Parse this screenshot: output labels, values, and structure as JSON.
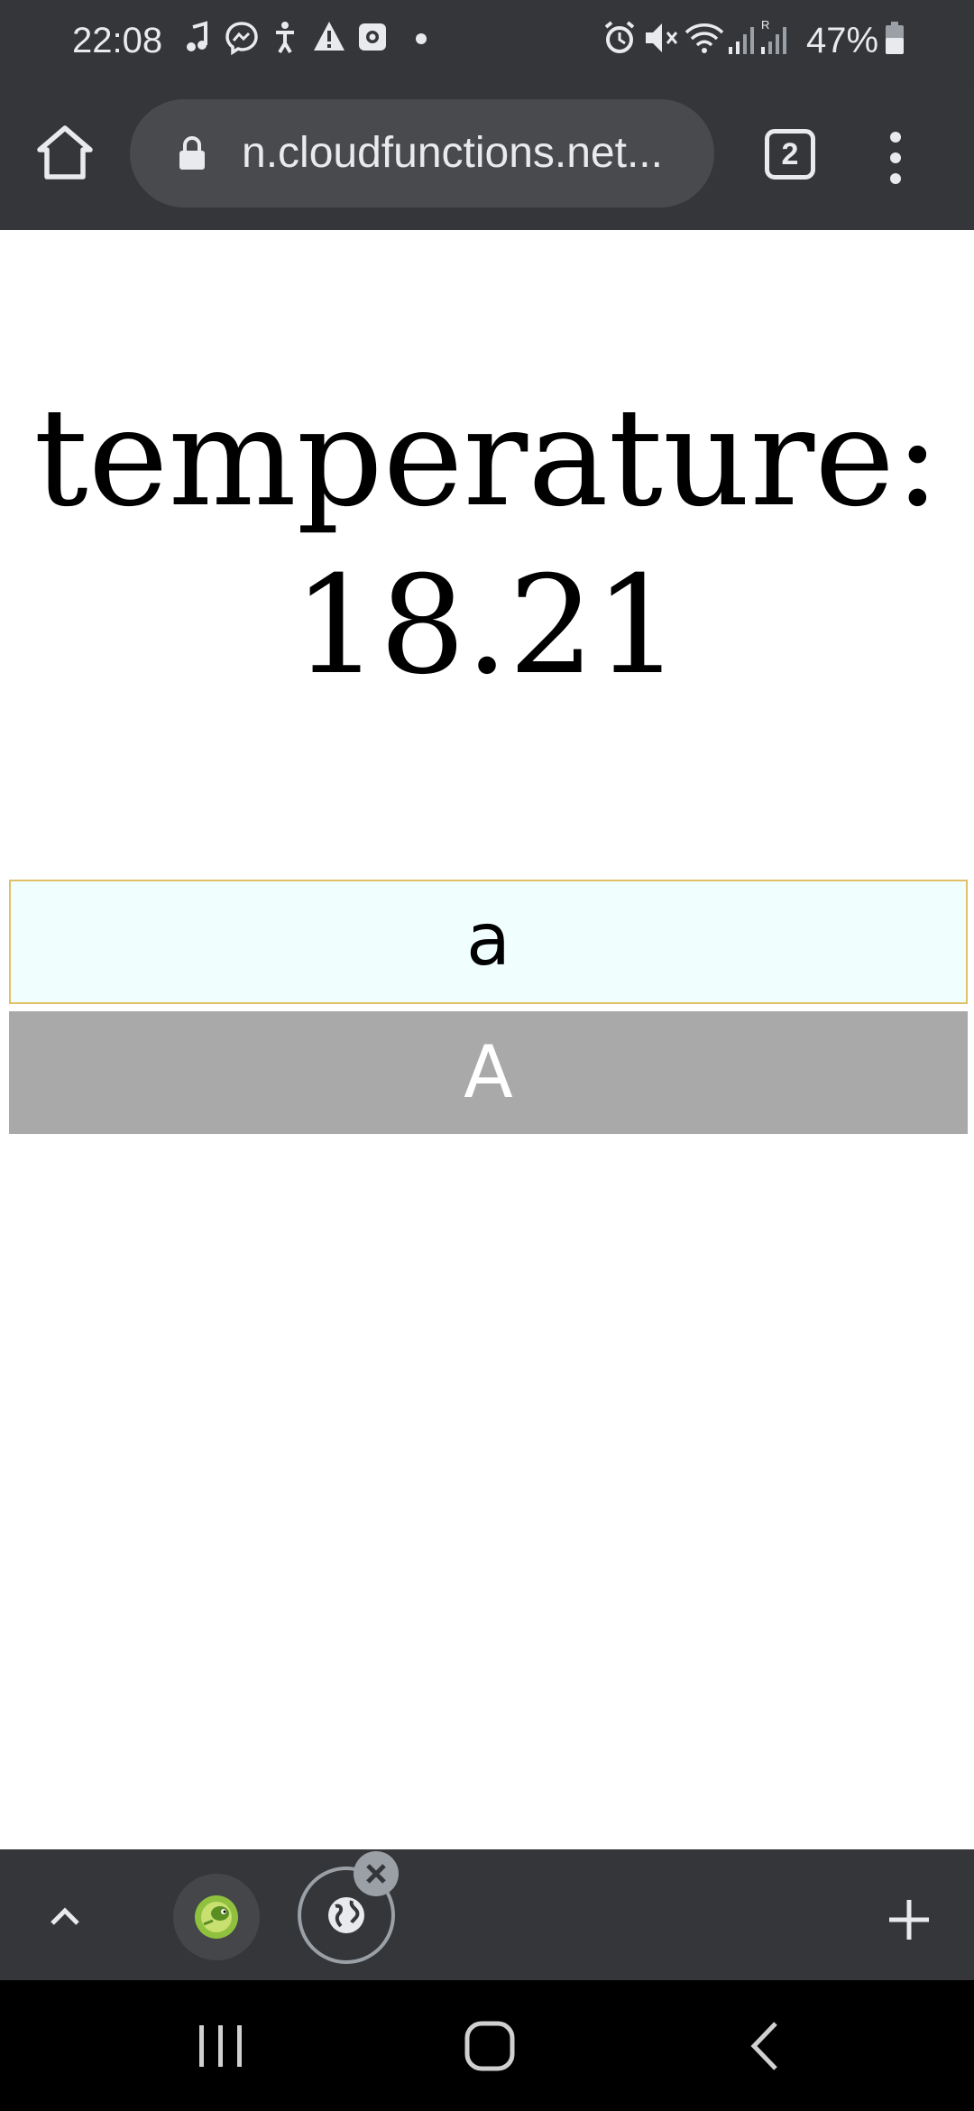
{
  "status_bar": {
    "time": "22:08",
    "battery": "47%",
    "icons": [
      "music-note-icon",
      "messenger-icon",
      "accessibility-icon",
      "warning-icon",
      "instagram-icon",
      "dot-icon",
      "alarm-icon",
      "mute-icon",
      "wifi-icon",
      "signal-icon",
      "roaming-signal-icon",
      "battery-icon"
    ]
  },
  "browser": {
    "url": "...n.cloudfunctions.net",
    "tab_count": "2",
    "icons": [
      "home-icon",
      "lock-icon",
      "more-vert-icon"
    ]
  },
  "page": {
    "heading": "temperature: 18.21",
    "lower_button_label": "a",
    "upper_button_label": "A",
    "lower_button_bg": "#f0fffe",
    "lower_button_border": "#e0c068",
    "upper_button_bg": "#a9a9a9"
  },
  "tab_bar": {
    "icons": [
      "chevron-up-icon",
      "duckduckgo-icon",
      "globe-icon",
      "close-icon",
      "plus-icon"
    ]
  },
  "nav_bar": {
    "icons": [
      "recents-icon",
      "home-circle-icon",
      "back-icon"
    ]
  },
  "colors": {
    "chrome": "#35363a",
    "url_field": "#494a4e",
    "page_bg": "#ffffff"
  }
}
